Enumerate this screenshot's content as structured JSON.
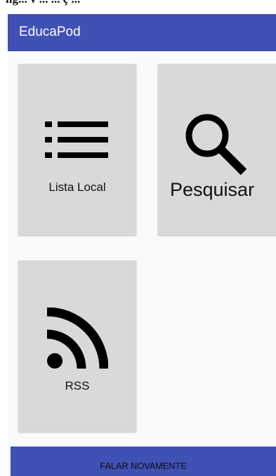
{
  "top_strip": {
    "text": "ng... v ... ... ç ..."
  },
  "app_bar": {
    "title": "EducaPod",
    "background_color": "#3f51b5"
  },
  "tiles": [
    {
      "label": "Lista Local",
      "icon": "list-icon"
    },
    {
      "label": "Pesquisar",
      "icon": "search-icon"
    },
    {
      "label": "RSS",
      "icon": "rss-icon"
    }
  ],
  "tile_color": "#d9d9d9",
  "bottom_button": {
    "label": "FALAR NOVAMENTE",
    "background_color": "#3f51b5"
  }
}
